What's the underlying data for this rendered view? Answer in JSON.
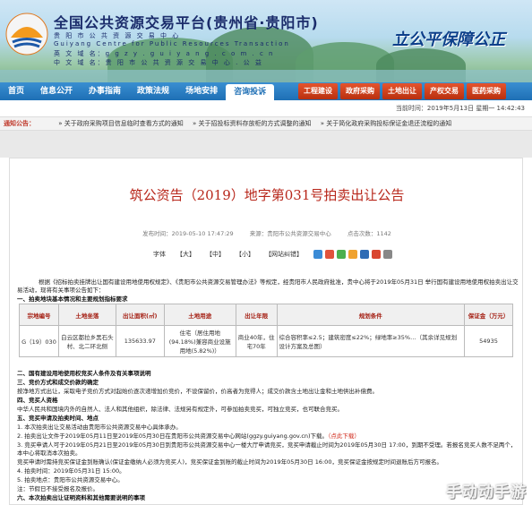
{
  "header": {
    "title": "全国公共资源交易平台(贵州省·贵阳市)",
    "sub1": "贵 阳 市 公 共 资 源 交 易 中 心",
    "sub2": "Guiyang Centre for Public Resources Transaction",
    "sub3": "英 文 域 名：g g z y . g u i y a n g . c o m . c n",
    "sub4": "中 文 域 名：贵 阳 市 公 共 资 源 交 易 中 心 . 公 益",
    "slogan": "立公平保障公正"
  },
  "nav": {
    "items": [
      "首页",
      "信息公开",
      "办事指南",
      "政策法规",
      "场地安排",
      "咨询投诉"
    ],
    "active_index": 5,
    "right_items": [
      "工程建设",
      "政府采购",
      "土地出让",
      "产权交易",
      "医药采购"
    ]
  },
  "datebar": {
    "text": "当前时间：2019年5月13日 星期一 14:42:43"
  },
  "notice": {
    "label": "通知公告：",
    "items": [
      "关于政府采购项目信息临时查看方式的通知",
      "关于招投标资料存放柜的方式调整的通知",
      "关于简化政府采购投标保证金退还流程的通知"
    ]
  },
  "doc": {
    "title": "筑公资告（2019）地字第031号拍卖出让公告",
    "meta_time": "发布时间：2019-05-10 17:47:29",
    "meta_source": "来源：贵阳市公共资源交易中心",
    "meta_views": "点击次数：1142",
    "font_label": "字体",
    "font_big": "【大】",
    "font_mid": "【中】",
    "font_small": "【小】",
    "font_web": "【网站纠错】",
    "intro": "根据《招标拍卖挂牌出让国有建设用地使用权规定》、《贵阳市公共资源交易管理办法》等规定，经贵阳市人民政府批准，贵中心将于2019年05月31日 举行国有建设用地使用权拍卖出让交易活动，现将有关事项公告如下：",
    "sec1": "一、拍卖地块基本情况和主要规划指标要求",
    "table": {
      "headers": [
        "宗地编号",
        "土地坐落",
        "出让面积(㎡)",
        "土地用途",
        "出让年限",
        "规划条件",
        "保证金（万元）"
      ],
      "row": [
        "G（19）030",
        "白云区都拉乡黑石头村、北二环北侧",
        "135633.97",
        "住宅（居住用地(94.18%)兼容商业设施用地(5.82%)）",
        "商业40年，住宅70年",
        "综合容积率≤2.5；建筑密度≤22%；绿地率≥35%…（其余详见规划设计方案及总图）",
        "54935"
      ]
    },
    "sec2": "二、国有建设用地使用权竞买人条件及有关事项说明",
    "sec3": "三、竞价方式和成交价款的确定",
    "p3": "按净地方式出让，采取电子竞价方式对起始价逐次递增加价竞价，不设保留价，价高者为竞得人；成交价款含土地出让金和土地供出补偿费。",
    "sec4": "四、竞买人资格",
    "p4": "中华人民共和国境内外的自然人、法人和其他组织，除法律、法规另有规定外，可参加拍卖竞买，可独立竞买，也可联合竞买。",
    "sec5": "五、竞买申请及拍卖时间、地点",
    "p5_1": "1. 本次拍卖出让交易活动由贵阳市公共资源交易中心具体承办。",
    "p5_2": "2. 拍卖出让文件于2019年05月11日至2019年05月30日在贵阳市公共资源交易中心网站(ggzy.guiyang.gov.cn)下载。",
    "p5_2_red": "（点此下载）",
    "p5_3": "3. 竞买申请人可于2019年05月21日至2019年05月30日到贵阳市公共资源交易中心一楼大厅申请竞买，竞买申请截止时间为2019年05月30日 17:00，到期不受理。若报名竞买人数不足两个，本中心将取消本次拍卖。",
    "p5_4": "竞买申请时需持竞买保证金到账确认(保证金缴纳人必须为竞买人)，竞买保证金到账的截止时间为2019年05月30日 16:00，竞买保证金按规定时间退账后方可报名。",
    "p5_5": "4. 拍卖时间：2019年05月31日 15:00。",
    "p5_6": "5. 拍卖地点：贵阳市公共资源交易中心。",
    "p5_7": "注：节假日不接受报名及报价。",
    "sec6": "六、本次拍卖出让证明资料和其他需要说明的事项"
  },
  "watermark": "手动动手游",
  "colors": {
    "nav": "#1e6fb5",
    "accent_red": "#b8271b",
    "tab_red": "#d2421e"
  }
}
